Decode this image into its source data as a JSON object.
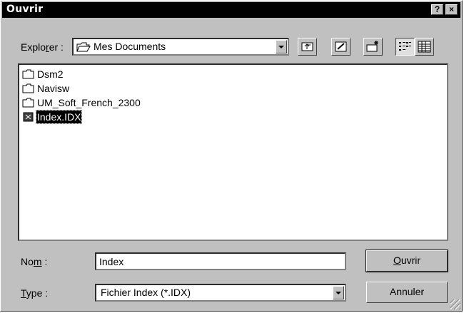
{
  "window": {
    "title": "Ouvrir",
    "help_button": "?",
    "close_button": "×"
  },
  "look_in": {
    "label_prefix": "Explo",
    "label_hotkey": "r",
    "label_suffix": "er :",
    "value": "Mes Documents"
  },
  "toolbar": {
    "icons": [
      "folder-up-icon",
      "desktop-icon",
      "new-folder-icon",
      "list-view-icon",
      "details-view-icon"
    ]
  },
  "files": [
    {
      "name": "Dsm2",
      "icon": "folder-icon",
      "selected": false
    },
    {
      "name": "Navisw",
      "icon": "folder-icon",
      "selected": false
    },
    {
      "name": "UM_Soft_French_2300",
      "icon": "folder-icon",
      "selected": false
    },
    {
      "name": "Index.IDX",
      "icon": "file-icon",
      "selected": true
    }
  ],
  "filename": {
    "label_prefix": "No",
    "label_hotkey": "m",
    "label_suffix": " :",
    "value": "Index"
  },
  "filetype": {
    "label_prefix": "",
    "label_hotkey": "T",
    "label_suffix": "ype :",
    "value": "Fichier Index  (*.IDX)"
  },
  "buttons": {
    "open_hotkey": "O",
    "open_rest": "uvrir",
    "cancel": "Annuler"
  },
  "colors": {
    "titlebar": "#000000",
    "face": "#c0c0c0",
    "selection": "#000000"
  }
}
